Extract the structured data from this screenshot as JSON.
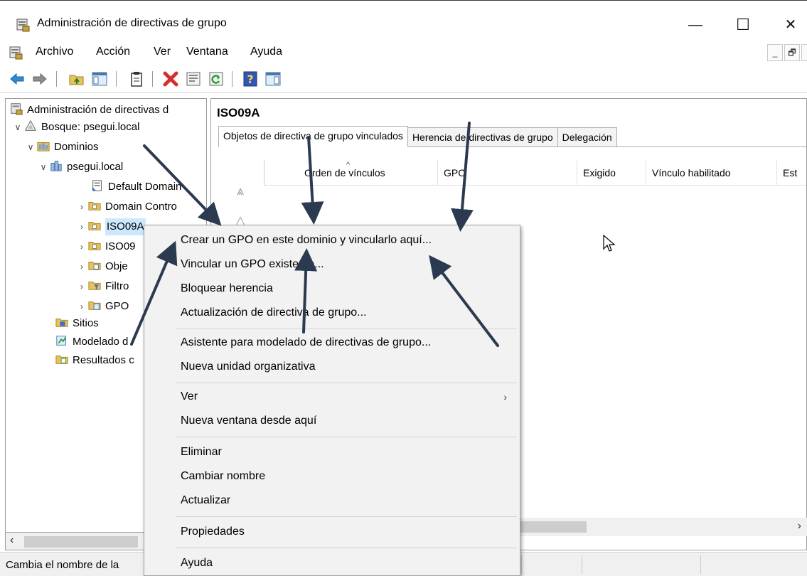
{
  "window": {
    "title": "Administración de directivas de grupo",
    "minimize": "—",
    "maximize": "☐",
    "close": "✕"
  },
  "menubar": {
    "items": [
      "Archivo",
      "Acción",
      "Ver",
      "Ventana",
      "Ayuda"
    ],
    "mdi_minimize": "_",
    "mdi_restore": "🗗",
    "mdi_close": "×"
  },
  "tree": {
    "root": "Administración de directivas d",
    "forest": "Bosque: psegui.local",
    "domains": "Dominios",
    "domain": "psegui.local",
    "default_policy": "Default Domain",
    "domain_controllers": "Domain Contro",
    "iso09a": "ISO09A",
    "iso09b": "ISO09",
    "objects": "Obje",
    "filters": "Filtro",
    "gpo": "GPO",
    "sites": "Sitios",
    "modeling": "Modelado d",
    "results": "Resultados c"
  },
  "panel": {
    "title": "ISO09A",
    "tabs": [
      "Objetos de directiva de grupo vinculados",
      "Herencia de directivas de grupo",
      "Delegación"
    ],
    "columns": [
      "Orden de vínculos",
      "GPO",
      "Exigido",
      "Vínculo habilitado",
      "Est"
    ]
  },
  "context_menu": {
    "items": [
      "Crear un GPO en este dominio y vincularlo aquí...",
      "Vincular un GPO existente...",
      "Bloquear herencia",
      "Actualización de directiva de grupo...",
      "Asistente para modelado de directivas de grupo...",
      "Nueva unidad organizativa",
      "Ver",
      "Nueva ventana desde aquí",
      "Eliminar",
      "Cambiar nombre",
      "Actualizar",
      "Propiedades",
      "Ayuda"
    ],
    "submenu_glyph": "›"
  },
  "status": {
    "text": "Cambia el nombre de la"
  },
  "colors": {
    "selection": "#cce8ff",
    "annotation_arrow": "#2b3a4f",
    "menu_background": "#f2f2f2"
  }
}
